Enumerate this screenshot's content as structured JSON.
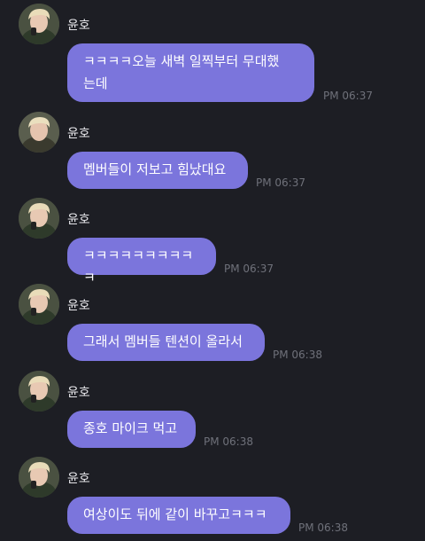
{
  "messages": [
    {
      "sender": "윤호",
      "text": "ㅋㅋㅋㅋ오늘 새벽 일찍부터 무대했는데",
      "line1": "ㅋㅋㅋㅋ오늘 새벽 일찍부터 무대했",
      "line2": "는데",
      "time": "PM 06:37"
    },
    {
      "sender": "윤호",
      "text": "멤버들이 저보고 힘났대요",
      "time": "PM 06:37"
    },
    {
      "sender": "윤호",
      "text": "ㅋㅋㅋㅋㅋㅋㅋㅋㅋㅋ",
      "time": "PM 06:37"
    },
    {
      "sender": "윤호",
      "text": "그래서 멤버들 텐션이 올라서",
      "time": "PM 06:38"
    },
    {
      "sender": "윤호",
      "text": "종호 마이크 먹고",
      "time": "PM 06:38"
    },
    {
      "sender": "윤호",
      "text": "여상이도 뒤에 같이 바꾸고ㅋㅋㅋ",
      "time": "PM 06:38"
    }
  ],
  "colors": {
    "background": "#1d1e24",
    "bubble": "#7b75dc",
    "sender_text": "#e6e6ea",
    "time_text": "#6f717a"
  },
  "icons": {
    "avatar": "profile-photo"
  }
}
